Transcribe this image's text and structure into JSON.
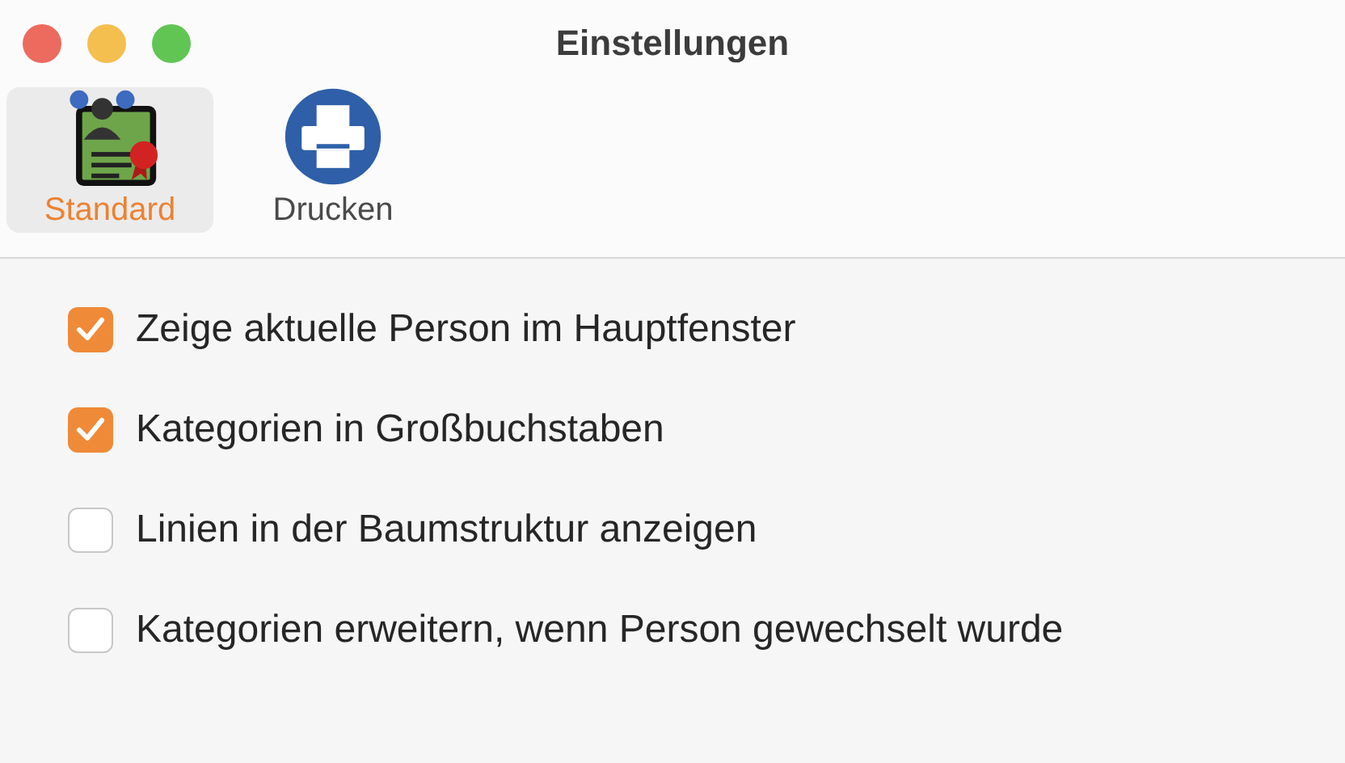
{
  "window": {
    "title": "Einstellungen"
  },
  "toolbar": [
    {
      "label": "Standard",
      "kind": "certificate",
      "selected": true
    },
    {
      "label": "Drucken",
      "kind": "printer",
      "selected": false
    }
  ],
  "options": [
    {
      "label": "Zeige aktuelle Person im Hauptfenster",
      "checked": true
    },
    {
      "label": "Kategorien in Großbuchstaben",
      "checked": true
    },
    {
      "label": "Linien in der Baumstruktur anzeigen",
      "checked": false
    },
    {
      "label": "Kategorien erweitern, wenn Person gewechselt wurde",
      "checked": false
    }
  ]
}
